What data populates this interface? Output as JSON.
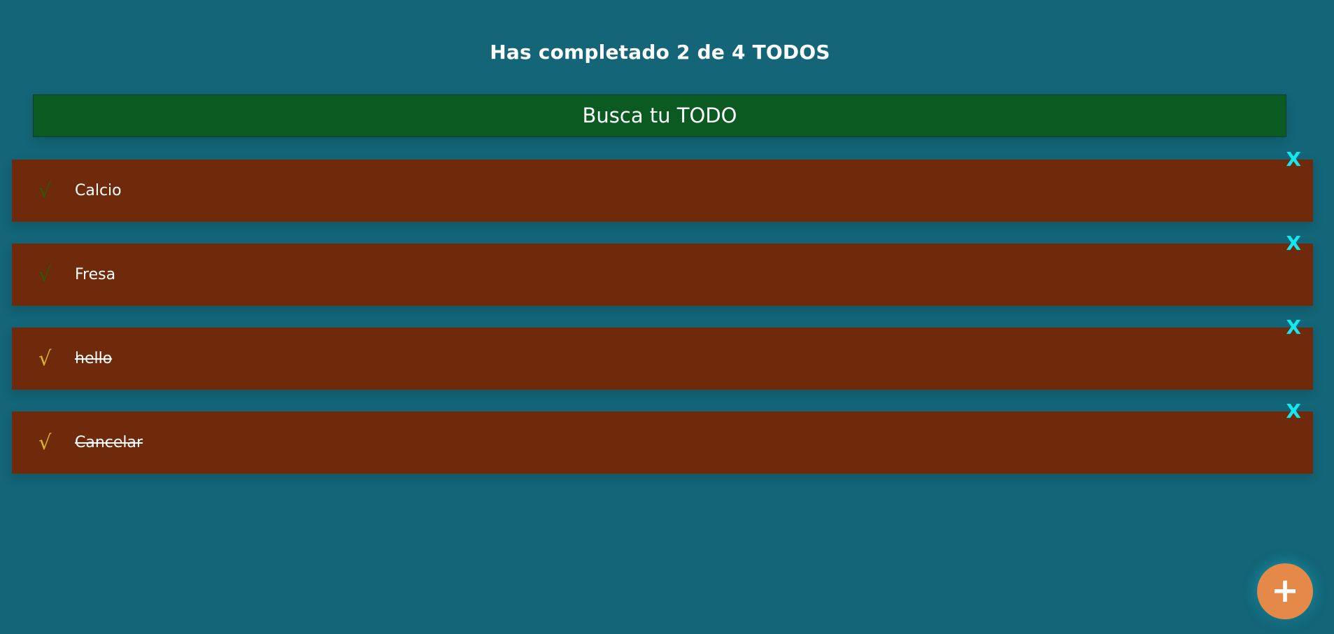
{
  "header": {
    "counter_text": "Has completado 2 de 4 TODOS"
  },
  "search": {
    "placeholder": "Busca tu TODO"
  },
  "todos": [
    {
      "text": "Calcio",
      "completed": false,
      "check_icon": "√",
      "delete_label": "X"
    },
    {
      "text": "Fresa",
      "completed": false,
      "check_icon": "√",
      "delete_label": "X"
    },
    {
      "text": "hello",
      "completed": true,
      "check_icon": "√",
      "delete_label": "X"
    },
    {
      "text": "Cancelar",
      "completed": true,
      "check_icon": "√",
      "delete_label": "X"
    }
  ],
  "fab": {
    "label": "+"
  },
  "colors": {
    "background": "#136577",
    "search_bg": "#0a5a22",
    "todo_bg": "#6f290b",
    "check_incomplete": "#2f5a06",
    "check_complete": "#d9b72a",
    "delete": "#15e7ef",
    "fab_bg": "#e48947"
  }
}
